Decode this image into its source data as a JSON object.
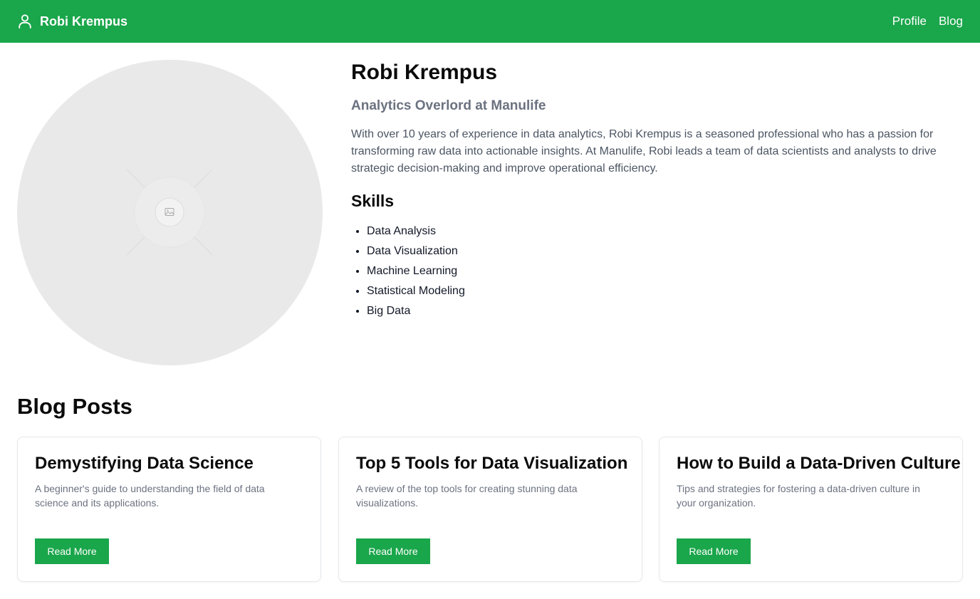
{
  "nav": {
    "brand_icon": "user-icon",
    "brand_name": "Robi Krempus",
    "links": [
      {
        "label": "Profile"
      },
      {
        "label": "Blog"
      }
    ]
  },
  "profile": {
    "avatar_icon": "image-placeholder-icon",
    "name": "Robi Krempus",
    "title": "Analytics Overlord at Manulife",
    "bio": "With over 10 years of experience in data analytics, Robi Krempus is a seasoned professional who has a passion for transforming raw data into actionable insights. At Manulife, Robi leads a team of data scientists and analysts to drive strategic decision-making and improve operational efficiency.",
    "skills_heading": "Skills",
    "skills": [
      "Data Analysis",
      "Data Visualization",
      "Machine Learning",
      "Statistical Modeling",
      "Big Data"
    ]
  },
  "blog": {
    "heading": "Blog Posts",
    "posts": [
      {
        "title": "Demystifying Data Science",
        "description": "A beginner's guide to understanding the field of data science and its applications.",
        "button": "Read More"
      },
      {
        "title": "Top 5 Tools for Data Visualization",
        "description": "A review of the top tools for creating stunning data visualizations.",
        "button": "Read More"
      },
      {
        "title": "How to Build a Data-Driven Culture",
        "description": "Tips and strategies for fostering a data-driven culture in your organization.",
        "button": "Read More"
      }
    ]
  },
  "colors": {
    "brand_green": "#1aa64b",
    "muted_text": "#6b7280",
    "placeholder_gray": "#e9e9e9"
  }
}
